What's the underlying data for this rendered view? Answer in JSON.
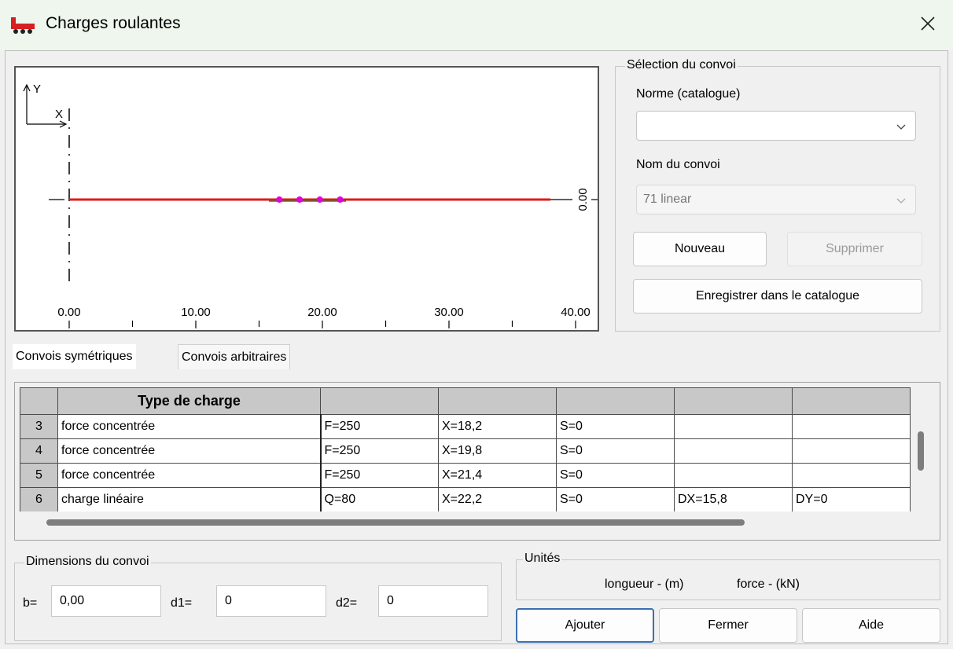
{
  "window": {
    "title": "Charges roulantes",
    "icon": "rolling-load-icon",
    "close_glyph": "✕"
  },
  "preview": {
    "y_axis_label": "Y",
    "x_axis_label": "X",
    "right_label": "0.00",
    "x_ticks": [
      "0.00",
      "10.00",
      "20.00",
      "30.00",
      "40.00"
    ],
    "line_color": "#e21a1a",
    "point_color": "#e000e0"
  },
  "selection": {
    "legend": "Sélection du convoi",
    "norme_label": "Norme (catalogue)",
    "norme_value": "",
    "nom_label": "Nom du convoi",
    "nom_value": "71 linear",
    "new_button": "Nouveau",
    "delete_button": "Supprimer",
    "save_button": "Enregistrer dans le catalogue"
  },
  "tabs": [
    {
      "label": "Convois symétriques",
      "active": true
    },
    {
      "label": "Convois arbitraires",
      "active": false
    }
  ],
  "table": {
    "header": [
      "",
      "Type de charge",
      "",
      "",
      "",
      "",
      ""
    ],
    "rows": [
      [
        "3",
        "force concentrée",
        "F=250",
        "X=18,2",
        "S=0",
        "",
        ""
      ],
      [
        "4",
        "force concentrée",
        "F=250",
        "X=19,8",
        "S=0",
        "",
        ""
      ],
      [
        "5",
        "force concentrée",
        "F=250",
        "X=21,4",
        "S=0",
        "",
        ""
      ],
      [
        "6",
        "charge linéaire",
        "Q=80",
        "X=22,2",
        "S=0",
        "DX=15,8",
        "DY=0"
      ]
    ]
  },
  "dimensions": {
    "legend": "Dimensions du convoi",
    "b_label": "b=",
    "b_value": "0,00",
    "d1_label": "d1=",
    "d1_value": "0",
    "d2_label": "d2=",
    "d2_value": "0"
  },
  "units": {
    "legend": "Unités",
    "text_length": "longueur - (m)",
    "text_force": "force - (kN)"
  },
  "footer": {
    "add_button": "Ajouter",
    "close_button": "Fermer",
    "help_button": "Aide"
  }
}
